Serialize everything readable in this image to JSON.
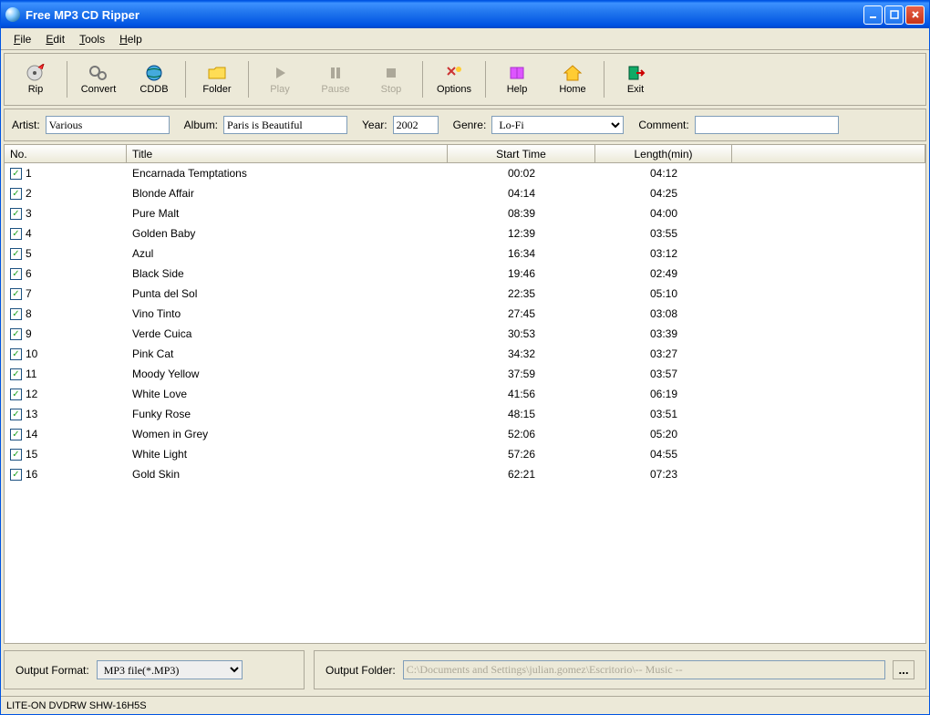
{
  "window": {
    "title": "Free MP3 CD Ripper"
  },
  "menu": {
    "file": "File",
    "edit": "Edit",
    "tools": "Tools",
    "help": "Help"
  },
  "toolbar": {
    "rip": "Rip",
    "convert": "Convert",
    "cddb": "CDDB",
    "folder": "Folder",
    "play": "Play",
    "pause": "Pause",
    "stop": "Stop",
    "options": "Options",
    "help": "Help",
    "home": "Home",
    "exit": "Exit"
  },
  "meta": {
    "artist_label": "Artist:",
    "artist": "Various",
    "album_label": "Album:",
    "album": "Paris is Beautiful",
    "year_label": "Year:",
    "year": "2002",
    "genre_label": "Genre:",
    "genre": "Lo-Fi",
    "comment_label": "Comment:",
    "comment": ""
  },
  "columns": {
    "no": "No.",
    "title": "Title",
    "start": "Start Time",
    "length": "Length(min)"
  },
  "tracks": [
    {
      "no": "1",
      "title": "Encarnada Temptations",
      "start": "00:02",
      "length": "04:12",
      "checked": true
    },
    {
      "no": "2",
      "title": "Blonde Affair",
      "start": "04:14",
      "length": "04:25",
      "checked": true
    },
    {
      "no": "3",
      "title": "Pure Malt",
      "start": "08:39",
      "length": "04:00",
      "checked": true
    },
    {
      "no": "4",
      "title": "Golden Baby",
      "start": "12:39",
      "length": "03:55",
      "checked": true
    },
    {
      "no": "5",
      "title": "Azul",
      "start": "16:34",
      "length": "03:12",
      "checked": true
    },
    {
      "no": "6",
      "title": "Black Side",
      "start": "19:46",
      "length": "02:49",
      "checked": true
    },
    {
      "no": "7",
      "title": "Punta del Sol",
      "start": "22:35",
      "length": "05:10",
      "checked": true
    },
    {
      "no": "8",
      "title": "Vino Tinto",
      "start": "27:45",
      "length": "03:08",
      "checked": true
    },
    {
      "no": "9",
      "title": "Verde Cuica",
      "start": "30:53",
      "length": "03:39",
      "checked": true
    },
    {
      "no": "10",
      "title": "Pink Cat",
      "start": "34:32",
      "length": "03:27",
      "checked": true
    },
    {
      "no": "11",
      "title": "Moody Yellow",
      "start": "37:59",
      "length": "03:57",
      "checked": true
    },
    {
      "no": "12",
      "title": "White Love",
      "start": "41:56",
      "length": "06:19",
      "checked": true
    },
    {
      "no": "13",
      "title": "Funky Rose",
      "start": "48:15",
      "length": "03:51",
      "checked": true
    },
    {
      "no": "14",
      "title": "Women in Grey",
      "start": "52:06",
      "length": "05:20",
      "checked": true
    },
    {
      "no": "15",
      "title": "White Light",
      "start": "57:26",
      "length": "04:55",
      "checked": true
    },
    {
      "no": "16",
      "title": "Gold Skin",
      "start": "62:21",
      "length": "07:23",
      "checked": true
    }
  ],
  "output": {
    "format_label": "Output Format:",
    "format": "MP3 file(*.MP3)",
    "folder_label": "Output Folder:",
    "folder": "C:\\Documents and Settings\\julian.gomez\\Escritorio\\-- Music --",
    "browse": "..."
  },
  "status": "LITE-ON DVDRW SHW-16H5S"
}
